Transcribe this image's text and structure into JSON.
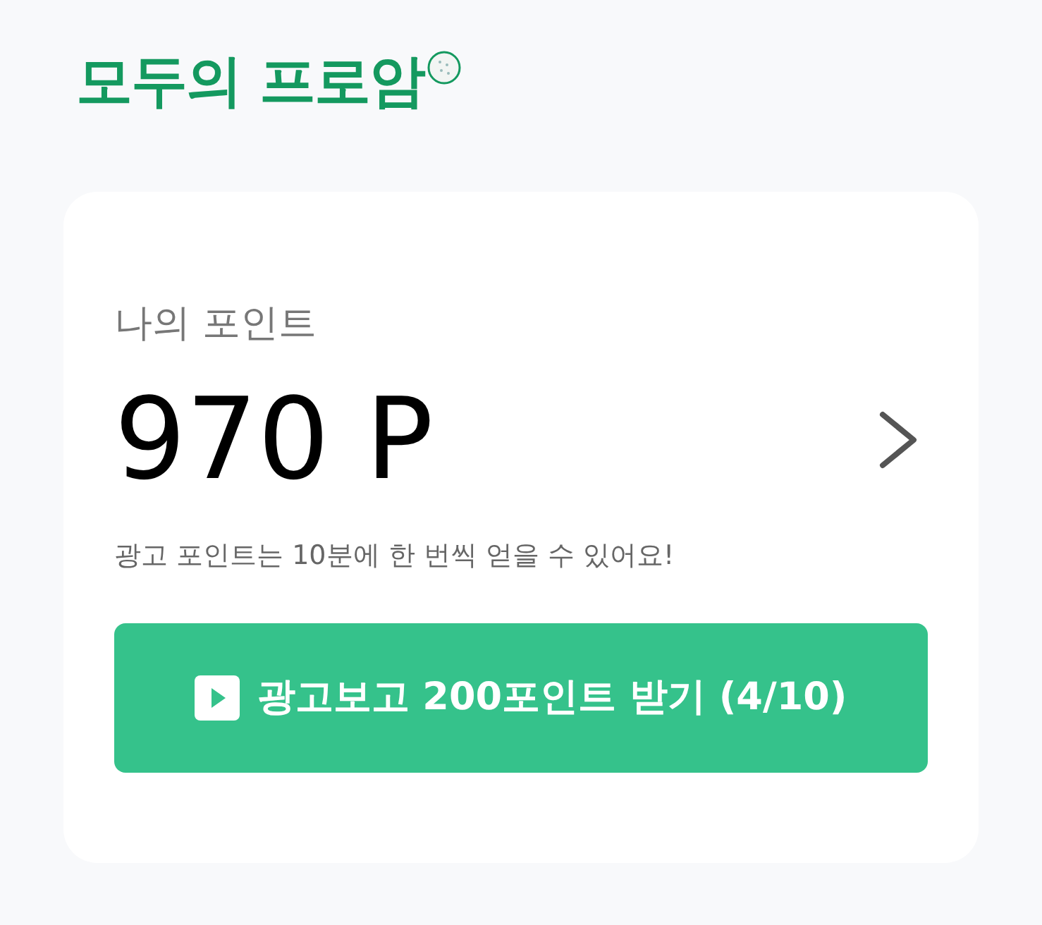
{
  "header": {
    "logo": "모두의 프로암"
  },
  "points_card": {
    "title": "나의 포인트",
    "value": "970 P",
    "note": "광고 포인트는 10분에 한 번씩 얻을 수 있어요!",
    "button": "광고보고 200포인트 받기 (4/10)"
  }
}
